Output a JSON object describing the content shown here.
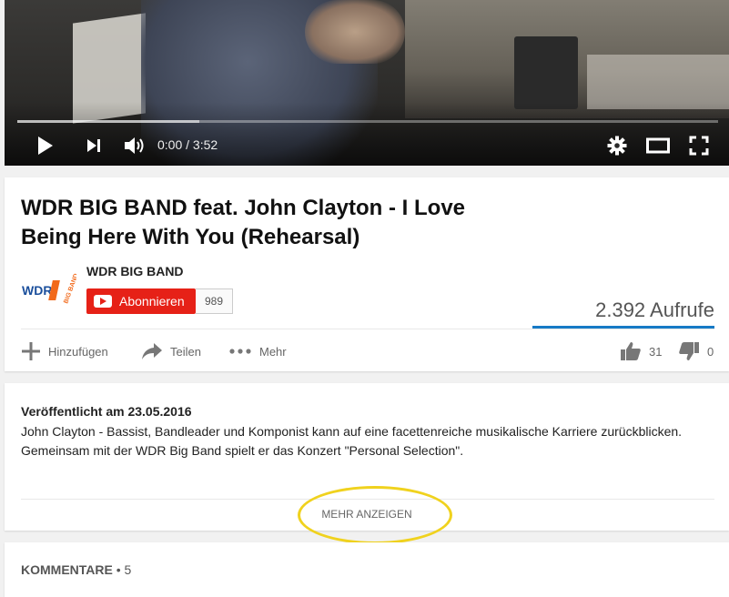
{
  "player": {
    "current_time": "0:00",
    "separator": "/",
    "duration": "3:52",
    "progress_loaded_fraction": 0.26,
    "icons": [
      "play-icon",
      "next-icon",
      "volume-icon",
      "settings-gear-icon",
      "theater-mode-icon",
      "fullscreen-icon"
    ]
  },
  "video": {
    "title": "WDR BIG BAND feat. John Clayton - I Love Being Here With You (Rehearsal)",
    "views": "2.392 Aufrufe"
  },
  "channel": {
    "name": "WDR BIG BAND",
    "logo_text_wdr": "WDR",
    "logo_text_band": "BIG BAND",
    "subscribe_label": "Abonnieren",
    "subscriber_count": "989"
  },
  "actions": {
    "add_label": "Hinzufügen",
    "share_label": "Teilen",
    "more_label": "Mehr",
    "likes": "31",
    "dislikes": "0"
  },
  "description": {
    "published": "Veröffentlicht am 23.05.2016",
    "text": "John Clayton - Bassist, Bandleader und Komponist kann auf eine facettenreiche musikalische Karriere zurückblicken. Gemeinsam mit der WDR Big Band spielt er das Konzert \"Personal Selection\".",
    "show_more": "MEHR ANZEIGEN"
  },
  "comments": {
    "label": "KOMMENTARE",
    "separator": "•",
    "count": "5"
  },
  "colors": {
    "subscribe_red": "#e62117",
    "views_bar_blue": "#167ac6",
    "highlight_yellow": "#f0d21e",
    "logo_orange": "#f26a1b"
  }
}
